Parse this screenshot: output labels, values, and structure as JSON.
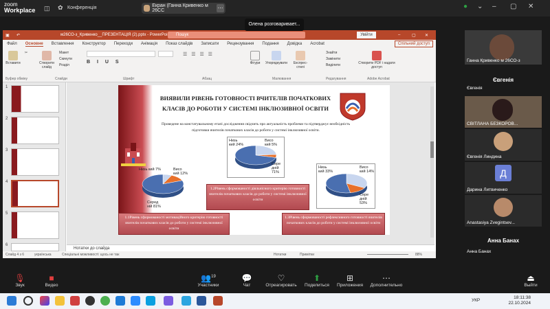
{
  "zoom": {
    "logo_top": "zoom",
    "logo_bottom": "Workplace",
    "conference_label": "Конференція",
    "screen_share_label": "Екран (Ганна Кривенко м 26СС",
    "speaking_label": "Олена розговаривает...",
    "bottom": {
      "audio": "Звук",
      "video": "Видео",
      "participants": "Участники",
      "participants_count": "19",
      "chat": "Чат",
      "react": "Отреагировать",
      "share": "Поделиться",
      "apps": "Приложения",
      "more": "Дополнительно",
      "exit": "Выйти"
    }
  },
  "ppt": {
    "title": "м26СО-з_Кривенко__ПРЕЗЕНТАЦІЯ (2).pptx - PowerPoint",
    "search": "Пошук",
    "login": "Увійти",
    "share": "Спільний доступ",
    "menu": [
      "Файл",
      "Основне",
      "Вставлення",
      "Конструктор",
      "Переходи",
      "Анімація",
      "Показ слайдів",
      "Записати",
      "Рецензування",
      "Подання",
      "Довідка",
      "Acrobat"
    ],
    "ribbon": {
      "paste": "Вставити",
      "clipboard": "Буфер обміну",
      "new_slide": "Створити слайд",
      "layout": "Макет",
      "reset": "Скинути",
      "section": "Розділ",
      "slides": "Слайди",
      "font": "Шрифт",
      "paragraph": "Абзац",
      "shapes": "Фігури",
      "arrange": "Упорядкувати",
      "styles": "Експрес-стилі",
      "drawing": "Малювання",
      "find": "Знайти",
      "replace": "Замінити",
      "select": "Виділити",
      "editing": "Редагування",
      "create_pdf": "Створити PDF і надати доступ",
      "adobe": "Adobe Acrobat"
    },
    "thumb_numbers": [
      "1",
      "2",
      "3",
      "4",
      "5",
      "6"
    ],
    "notes": "Нотатки до слайда",
    "status": {
      "slide": "Слайд 4 з 6",
      "lang": "українська",
      "access": "Спеціальні можливості: щось не так",
      "notes": "Нотатки",
      "comments": "Примітки",
      "zoom": "88%"
    }
  },
  "slide": {
    "heading": "ВИЯВИЛИ РІВЕНЬ ГОТОВНОСТІ ВЧИТЕЛІВ ПОЧАТКОВИХ КЛАСІВ ДО РОБОТИ У СИСТЕМІ ІНКЛЮЗИВНОЇ ОСВІТИ",
    "subtitle": "Проведене на констатувальному етапі дослідження свідчить про актуальність проблеми та підтверджує необхідність підготовки вчителів початкових класів до роботи у системі інклюзивної освіти.",
    "box1": "1.1Рівень сформованості мотиваційного критерію готовності вчителів початкових класів до роботи у системі інклюзивної освіти",
    "box2": "1.2Рівень сформованості діяльнісного критерію готовності вчителів початкових класів до роботи у системі інклюзивної освіти",
    "box3": "1.3Рівень сформованості рефлексивного готовності вчителів початкових класів до роботи у системі інклюзивної освіти",
    "emblem_text": "ХНУ ІНКЛЮЗИВНА ОСВІТА"
  },
  "chart_data": [
    {
      "type": "pie",
      "categories": [
        "Низький",
        "Високий",
        "Середній"
      ],
      "values": [
        7,
        12,
        81
      ],
      "labels": [
        "Низь кий 7%",
        "Висо кий 12%",
        "Серед ній 81%"
      ]
    },
    {
      "type": "pie",
      "categories": [
        "Низький",
        "Високий",
        "Середній"
      ],
      "values": [
        24,
        5,
        71
      ],
      "labels": [
        "Низь кий 24%",
        "Висо кий 5%",
        "Сере дній 71%"
      ]
    },
    {
      "type": "pie",
      "categories": [
        "Низький",
        "Високий",
        "Середній"
      ],
      "values": [
        33,
        14,
        53
      ],
      "labels": [
        "Низь кий 33%",
        "Висо кий 14%",
        "Сере дній 53%"
      ]
    }
  ],
  "participants": [
    {
      "name": "Ганна Кривенко м 26СО-з"
    },
    {
      "name": "Євгенія",
      "label": "Євгенія"
    },
    {
      "name": "СВІТЛАНА БЕЗКОРОВ..."
    },
    {
      "name": "Євгенія Линдина"
    },
    {
      "name": "Дарина Литвиченко",
      "initial": "Д"
    },
    {
      "name": "Anastasiya Zvegintsev..."
    },
    {
      "name": "Анна Банах",
      "label": "Анна Банах"
    }
  ],
  "taskbar": {
    "lang": "УКР",
    "time": "18:11:38",
    "date": "22.10.2024"
  },
  "colors": {
    "ppt_red": "#b7472a",
    "pie_blue": "#4a6fb0",
    "pie_orange": "#e8702a",
    "pie_light": "#c8d6ef"
  }
}
